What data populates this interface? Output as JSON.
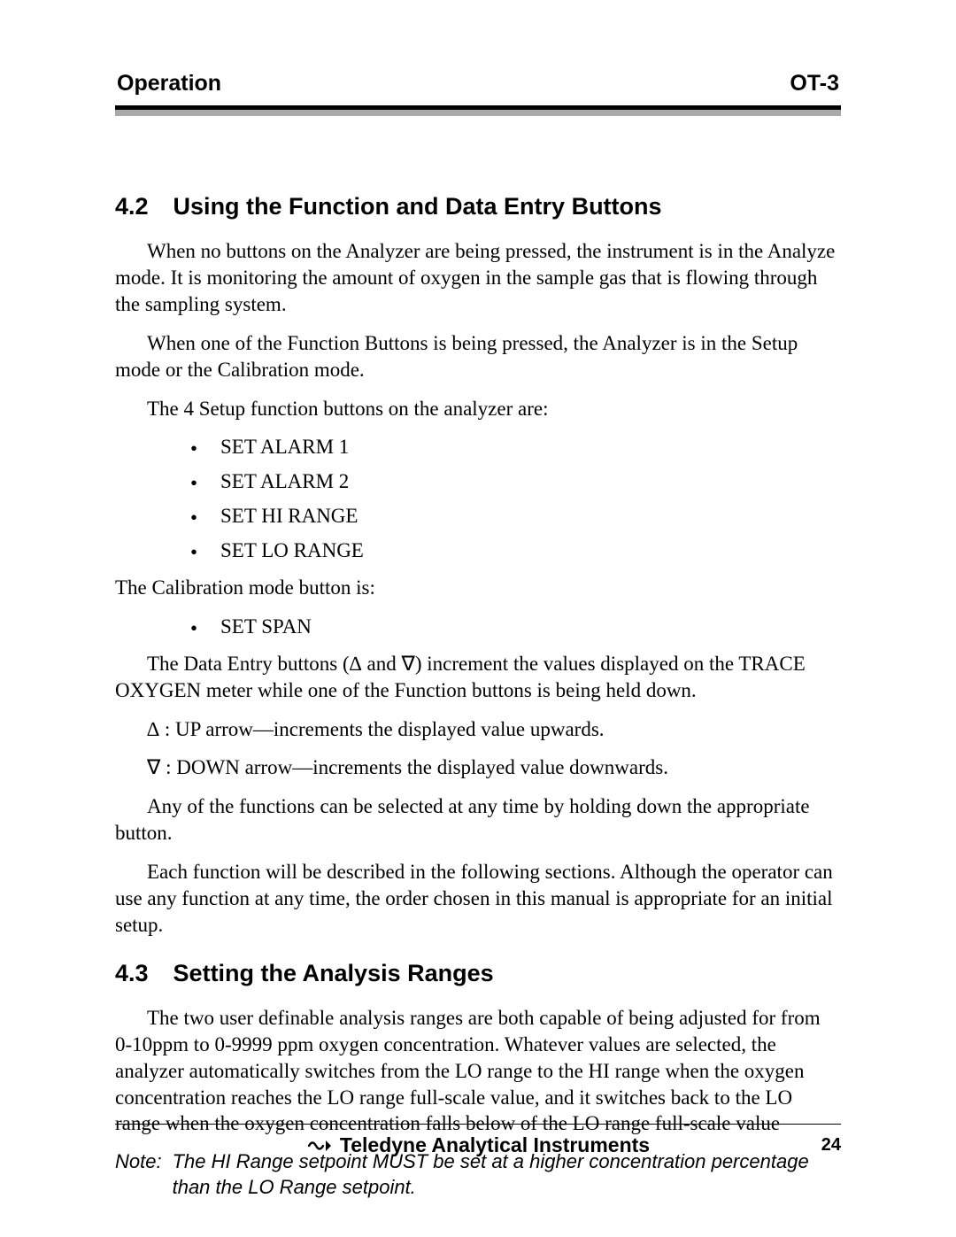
{
  "header": {
    "left": "Operation",
    "right": "OT-3"
  },
  "section42": {
    "number": "4.2",
    "title": "Using the Function and Data Entry Buttons",
    "p1": "When no buttons on the Analyzer are being pressed, the instrument is in the Analyze mode. It is monitoring the amount of oxygen in the sample gas that is flowing through the sampling system.",
    "p2": "When one of the Function Buttons is being pressed, the Analyzer is in the Setup mode or the Calibration mode.",
    "p3": "The 4 Setup function buttons on the analyzer are:",
    "setup_buttons": [
      "SET ALARM 1",
      "SET ALARM 2",
      "SET HI RANGE",
      "SET LO RANGE"
    ],
    "p4": "The Calibration mode button is:",
    "cal_buttons": [
      "SET SPAN"
    ],
    "p5": "The Data Entry buttons (∆ and ∇) increment the values displayed on the TRACE OXYGEN meter while one of the Function buttons is being held down.",
    "arrow_up": "∆ : UP arrow—increments the displayed value upwards.",
    "arrow_down": "∇ :  DOWN arrow—increments the displayed value downwards.",
    "p6": "Any of the functions can be selected at any time by holding down the appropriate button.",
    "p7": "Each function will be described in the following sections. Although the operator can use any function at any time, the order chosen in this manual is appropriate for an initial setup."
  },
  "section43": {
    "number": "4.3",
    "title": "Setting the Analysis Ranges",
    "p1": "The two user definable analysis ranges are both capable of being adjusted for from 0-10ppm to 0-9999 ppm oxygen concentration. Whatever values are selected, the analyzer automatically switches from the LO range to the HI range when the oxygen concentration reaches the LO range full-scale value, and it switches back to the LO range when the oxygen concentration falls below of the LO range full-scale value",
    "note_label": "Note:",
    "note_text": "The HI Range setpoint MUST be set at a higher concentration percentage than the LO Range setpoint."
  },
  "footer": {
    "company": "Teledyne Analytical Instruments",
    "page_num": "24"
  }
}
